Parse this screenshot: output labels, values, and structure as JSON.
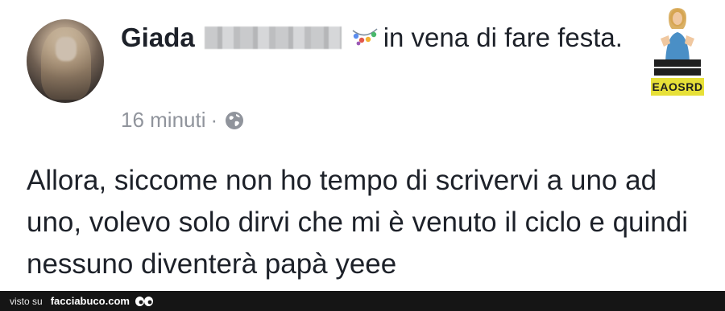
{
  "post": {
    "author_name": "Giada",
    "activity": "in vena di fare festa.",
    "timestamp": "16 minuti",
    "separator": "·",
    "privacy_icon": "globe-icon",
    "activity_icon": "party-lights-icon",
    "body": "Allora, siccome non ho tempo di scrivervi a uno ad uno, volevo solo dirvi che mi è venuto il ciclo e quindi nessuno diventerà papà yeee"
  },
  "badge": {
    "logo": "EAOSRD",
    "colors": {
      "logo_bg": "#e7e038",
      "strip_bg": "#1f1f1f"
    }
  },
  "footer": {
    "prefix": "visto su",
    "site": "facciabuco.com",
    "icon": "eyes-icon"
  },
  "colors": {
    "text": "#1d2129",
    "meta": "#90949c",
    "footer_bg": "#151515"
  }
}
